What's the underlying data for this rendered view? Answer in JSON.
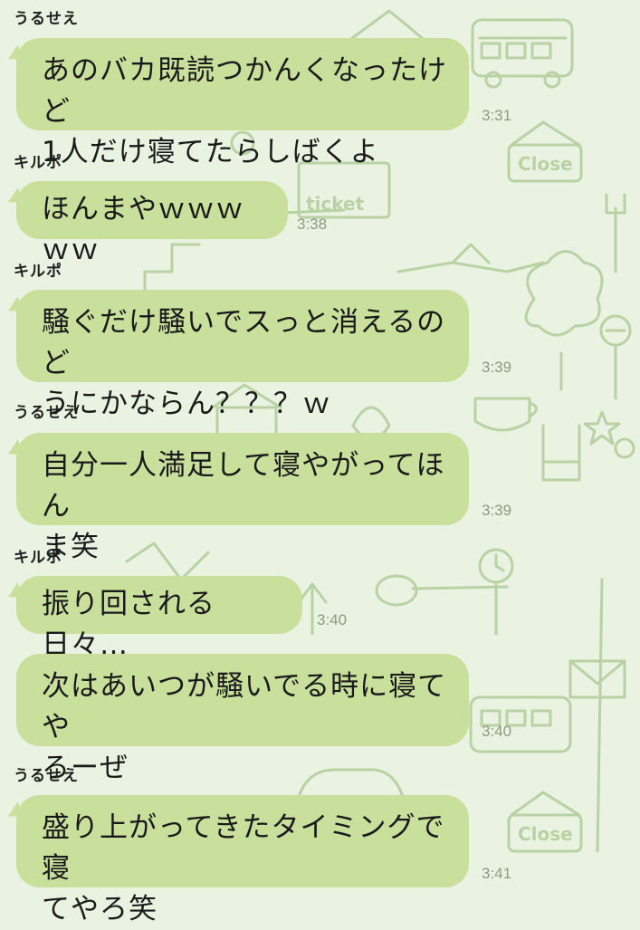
{
  "messages": [
    {
      "sender": "うるせえ",
      "lines": [
        "あのバカ既読つかんくなったけど",
        "1人だけ寝てたらしばくよ"
      ],
      "time": "3:31"
    },
    {
      "sender": "キルポ",
      "lines": [
        "ほんまやｗｗｗｗｗ"
      ],
      "time": "3:38"
    },
    {
      "sender": "キルポ",
      "lines": [
        "騒ぐだけ騒いでスっと消えるのど",
        "うにかならん？？？ｗ"
      ],
      "time": "3:39"
    },
    {
      "sender": "うるせえ",
      "lines": [
        "自分一人満足して寝やがってほん",
        "ま笑"
      ],
      "time": "3:39"
    },
    {
      "sender": "キルポ",
      "lines": [
        "振り回される日々…"
      ],
      "time": "3:40"
    },
    {
      "sender": "",
      "lines": [
        "次はあいつが騒いでる時に寝てや",
        "ろーぜ"
      ],
      "time": "3:40"
    },
    {
      "sender": "うるせえ",
      "lines": [
        "盛り上がってきたタイミングで寝",
        "てやろ笑"
      ],
      "time": "3:41"
    }
  ],
  "background": {
    "doodle_labels": [
      "Close",
      "ticket",
      "Close"
    ],
    "colors": {
      "wallpaper": "#eaf2e1",
      "doodle": "#b9d2a4",
      "bubble": "#c9df9c",
      "timestamp": "#8c9a80"
    }
  }
}
